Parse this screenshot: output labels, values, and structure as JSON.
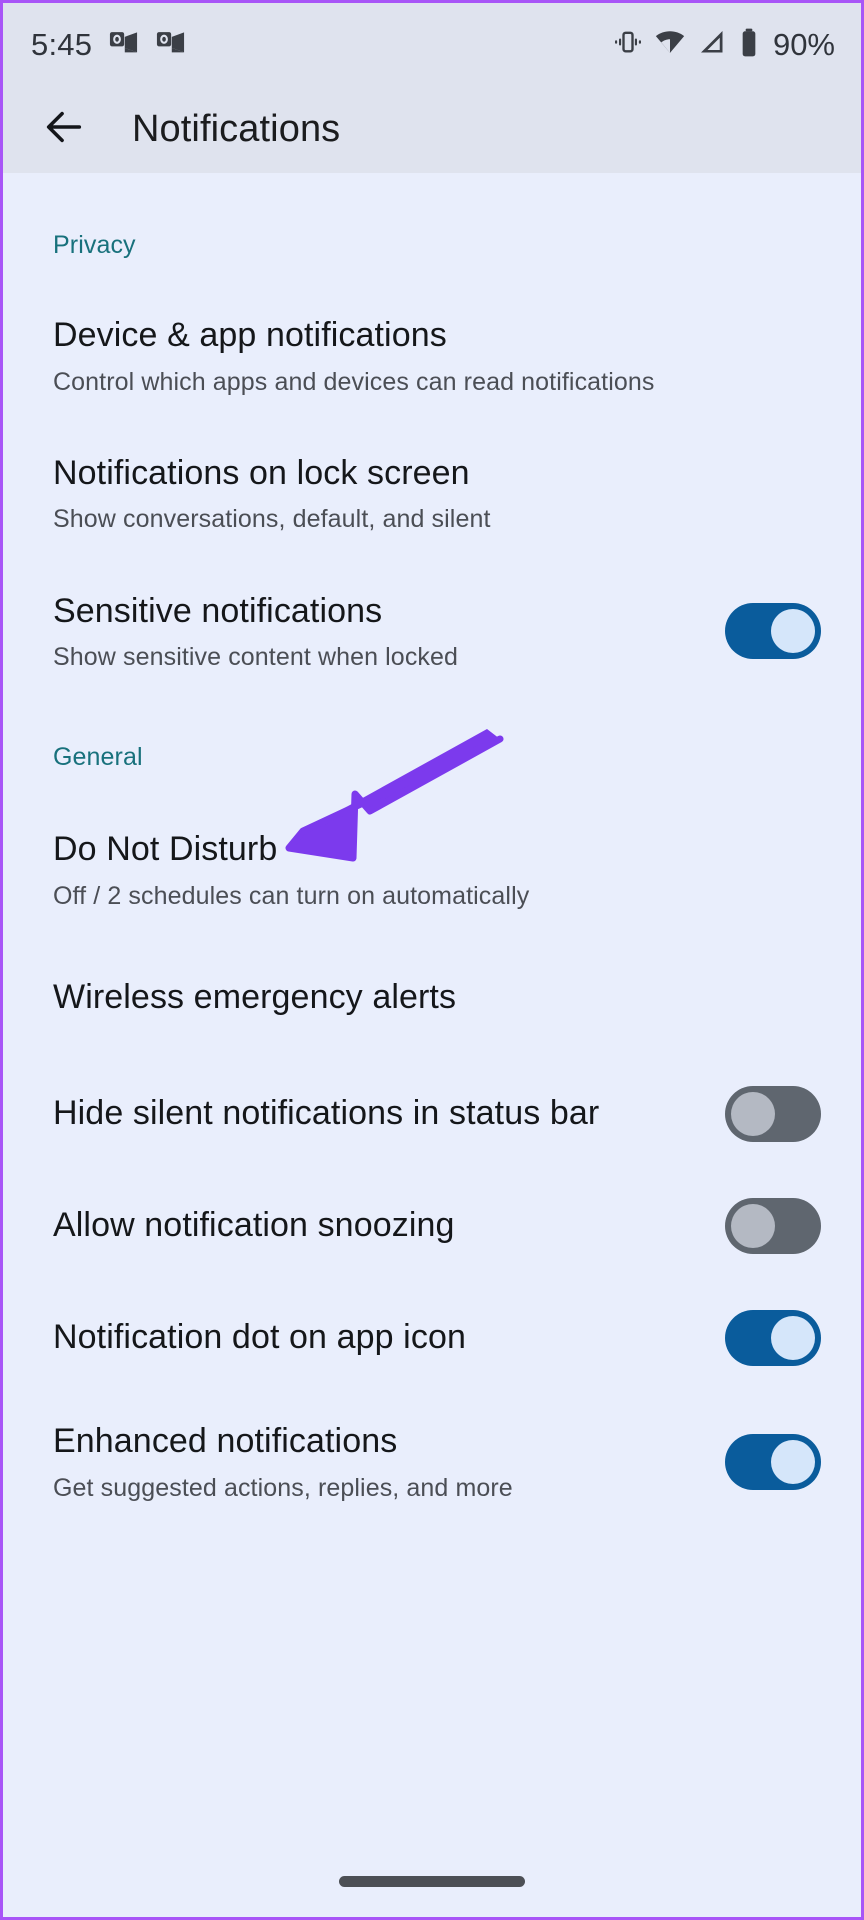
{
  "status_bar": {
    "time": "5:45",
    "battery_percent": "90%",
    "icons": [
      "outlook-notification-icon",
      "outlook-notification-icon",
      "vibrate-icon",
      "wifi-icon",
      "cellular-signal-icon",
      "battery-icon"
    ]
  },
  "app_bar": {
    "back_label": "Back",
    "title": "Notifications"
  },
  "sections": [
    {
      "header": "Privacy",
      "items": [
        {
          "title": "Device & app notifications",
          "subtitle": "Control which apps and devices can read notifications",
          "control": "none"
        },
        {
          "title": "Notifications on lock screen",
          "subtitle": "Show conversations, default, and silent",
          "control": "none"
        },
        {
          "title": "Sensitive notifications",
          "subtitle": "Show sensitive content when locked",
          "control": "toggle",
          "toggle_state": "on"
        }
      ]
    },
    {
      "header": "General",
      "items": [
        {
          "title": "Do Not Disturb",
          "subtitle": "Off / 2 schedules can turn on automatically",
          "control": "none"
        },
        {
          "title": "Wireless emergency alerts",
          "subtitle": "",
          "control": "none"
        },
        {
          "title": "Hide silent notifications in status bar",
          "subtitle": "",
          "control": "toggle",
          "toggle_state": "off"
        },
        {
          "title": "Allow notification snoozing",
          "subtitle": "",
          "control": "toggle",
          "toggle_state": "off"
        },
        {
          "title": "Notification dot on app icon",
          "subtitle": "",
          "control": "toggle",
          "toggle_state": "on"
        },
        {
          "title": "Enhanced notifications",
          "subtitle": "Get suggested actions, replies, and more",
          "control": "toggle",
          "toggle_state": "on"
        }
      ]
    }
  ],
  "annotation": {
    "type": "arrow",
    "points_to": "Do Not Disturb",
    "color": "#7c3aed"
  },
  "nav_bar": {
    "gesture_pill": "home-gesture-pill"
  },
  "colors": {
    "screen_background": "#e9eefc",
    "bar_background": "#dfe3ee",
    "section_header": "#18717c",
    "toggle_on_track": "#0a5c9c",
    "toggle_on_thumb": "#d5e6fa",
    "toggle_off_track": "#5f666f",
    "toggle_off_thumb": "#b4b9c3",
    "annotation_purple": "#7c3aed",
    "border_purple": "#a855f7"
  }
}
